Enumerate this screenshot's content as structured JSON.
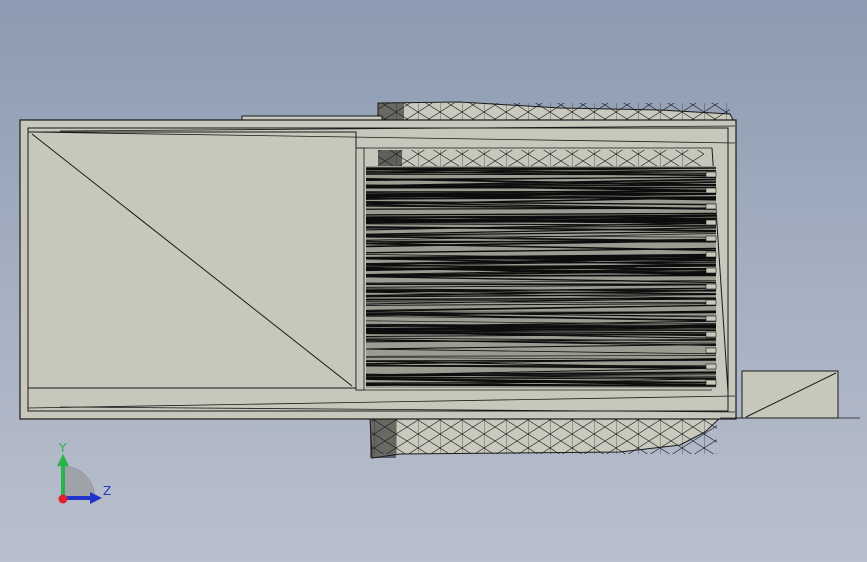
{
  "viewport": {
    "background_top": "#8c9bb1",
    "background_bottom": "#b9bfcc",
    "model_face_color": "#c7c8bb",
    "edge_color": "#1a1a1a"
  },
  "triad": {
    "y_label": "Y",
    "z_label": "Z",
    "y_color": "#2bb34a",
    "z_color": "#2233cc",
    "x_color": "#e0202a"
  }
}
